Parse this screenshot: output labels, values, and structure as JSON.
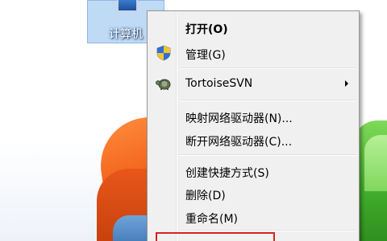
{
  "desktop": {
    "computer_icon": {
      "label": "计算机"
    }
  },
  "context_menu": {
    "items": [
      {
        "label": "打开(O)",
        "bold": true
      },
      {
        "label": "管理(G)",
        "icon": "shield-icon"
      },
      {
        "label": "TortoiseSVN",
        "icon": "tortoise-svn-icon",
        "submenu": true
      },
      {
        "label": "映射网络驱动器(N)..."
      },
      {
        "label": "断开网络驱动器(C)..."
      },
      {
        "label": "创建快捷方式(S)"
      },
      {
        "label": "删除(D)"
      },
      {
        "label": "重命名(M)"
      }
    ]
  },
  "colors": {
    "highlight_border": "#d9231f",
    "selected_icon_bg": "#aacdf0"
  }
}
